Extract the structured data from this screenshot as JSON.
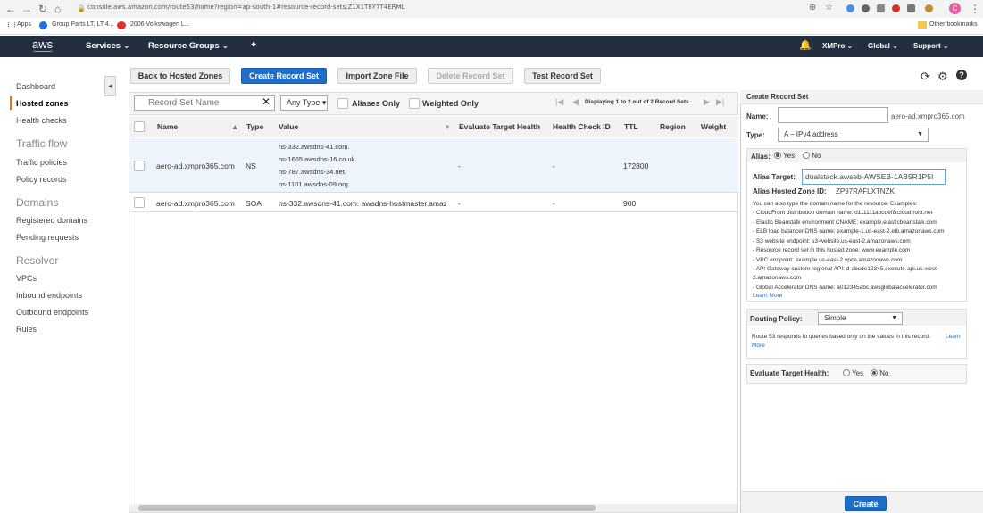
{
  "browser": {
    "url": "console.aws.amazon.com/route53/home?region=ap-south-1#resource-record-sets:Z1X1T6Y7T4ERML",
    "bookmarks": [
      "Apps",
      "Group Parts LT, LT 4...",
      "2006 Volkswagen L..."
    ],
    "other_bookmarks": "Other bookmarks",
    "profile_initial": "C"
  },
  "aws_nav": {
    "logo": "aws",
    "services": "Services ⌄",
    "resource_groups": "Resource Groups ⌄",
    "account": "XMPro ⌄",
    "region": "Global ⌄",
    "support": "Support ⌄"
  },
  "sidebar": {
    "items_top": [
      "Dashboard",
      "Hosted zones",
      "Health checks"
    ],
    "traffic_flow_heading": "Traffic flow",
    "traffic_items": [
      "Traffic policies",
      "Policy records"
    ],
    "domains_heading": "Domains",
    "domains_items": [
      "Registered domains",
      "Pending requests"
    ],
    "resolver_heading": "Resolver",
    "resolver_items": [
      "VPCs",
      "Inbound endpoints",
      "Outbound endpoints",
      "Rules"
    ]
  },
  "toolbar": {
    "back": "Back to Hosted Zones",
    "create": "Create Record Set",
    "import": "Import Zone File",
    "delete": "Delete Record Set",
    "test": "Test Record Set"
  },
  "filter": {
    "search_placeholder": "Record Set Name",
    "type_select": "Any Type",
    "aliases_only": "Aliases Only",
    "weighted_only": "Weighted Only",
    "pagination": "Displaying 1 to 2 out of 2 Record Sets"
  },
  "table": {
    "headers": [
      "Name",
      "Type",
      "Value",
      "Evaluate Target Health",
      "Health Check ID",
      "TTL",
      "Region",
      "Weight"
    ],
    "rows": [
      {
        "name": "aero-ad.xmpro365.com",
        "type": "NS",
        "values": [
          "ns-332.awsdns-41.com.",
          "ns-1665.awsdns-16.co.uk.",
          "ns-787.awsdns-34.net.",
          "ns-1101.awsdns-09.org."
        ],
        "eval": "-",
        "health": "-",
        "ttl": "172800"
      },
      {
        "name": "aero-ad.xmpro365.com",
        "type": "SOA",
        "values": [
          "ns-332.awsdns-41.com. awsdns-hostmaster.amazor"
        ],
        "eval": "-",
        "health": "-",
        "ttl": "900"
      }
    ]
  },
  "panel": {
    "title": "Create Record Set",
    "name_label": "Name:",
    "name_suffix": "aero-ad.xmpro365.com",
    "type_label": "Type:",
    "type_value": "A – IPv4 address",
    "alias_label": "Alias:",
    "yes": "Yes",
    "no": "No",
    "alias_target_label": "Alias Target:",
    "alias_target_value": "dualstack.awseb-AWSEB-1AB5R1P5I",
    "hosted_zone_label": "Alias Hosted Zone ID:",
    "hosted_zone_value": "ZP97RAFLXTNZK",
    "help_lines": [
      "You can also type the domain name for the resource. Examples:",
      "- CloudFront distribution domain name: d111111abcdef8.cloudfront.net",
      "- Elastic Beanstalk environment CNAME: example.elasticbeanstalk.com",
      "- ELB load balancer DNS name: example-1.us-east-2.elb.amazonaws.com",
      "- S3 website endpoint: s3-website.us-east-2.amazonaws.com",
      "- Resource record set in this hosted zone: www.example.com",
      "- VPC endpoint: example.us-east-2.vpce.amazonaws.com",
      "- API Gateway custom regional API: d-abcde12345.execute-api.us-west-",
      "2.amazonaws.com",
      "- Global Accelerator DNS name: a012345abc.awsglobalaccelerator.com"
    ],
    "learn_more": "Learn More",
    "routing_label": "Routing Policy:",
    "routing_value": "Simple",
    "routing_help_1": "Route 53 responds to queries based only on the values in this record.",
    "routing_learn": "Learn",
    "routing_more": "More",
    "eval_label": "Evaluate Target Health:",
    "create_button": "Create"
  }
}
